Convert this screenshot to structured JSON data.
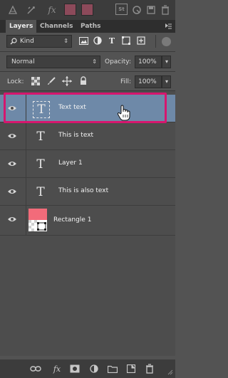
{
  "toolbar_top": {
    "icons": [
      "transform-icon",
      "warp-icon",
      "fx-icon",
      "color-swatch",
      "color-swatch",
      "st-badge-icon",
      "refresh-icon",
      "save-icon",
      "trash-icon"
    ],
    "fx_label": "fx",
    "st_label": "St"
  },
  "tabs": [
    {
      "label": "Layers",
      "active": true
    },
    {
      "label": "Channels",
      "active": false
    },
    {
      "label": "Paths",
      "active": false
    }
  ],
  "filter": {
    "kind_label": "Kind",
    "icons": [
      "image-filter-icon",
      "adjustment-filter-icon",
      "type-filter-icon",
      "shape-filter-icon",
      "smart-filter-icon"
    ]
  },
  "blend": {
    "mode": "Normal",
    "opacity_label": "Opacity:",
    "opacity_value": "100%"
  },
  "lock": {
    "label": "Lock:",
    "fill_label": "Fill:",
    "fill_value": "100%"
  },
  "layers": [
    {
      "name": "Text text",
      "type": "text",
      "selected": true
    },
    {
      "name": "This is text",
      "type": "text",
      "selected": false
    },
    {
      "name": "Layer 1",
      "type": "text",
      "selected": false
    },
    {
      "name": "This is also text",
      "type": "text",
      "selected": false
    },
    {
      "name": "Rectangle 1",
      "type": "shape",
      "selected": false
    }
  ],
  "text_thumb_glyph": "T",
  "bottom_bar": {
    "icons": [
      "link-icon",
      "fx-icon",
      "mask-icon",
      "adjustment-icon",
      "group-folder-icon",
      "new-layer-icon",
      "trash-icon"
    ],
    "fx_label": "fx"
  },
  "colors": {
    "panel_bg": "#535353",
    "selected_row": "#6e89a8",
    "highlight_border": "#d6166e",
    "shape_thumb_red": "#f26b7a"
  }
}
